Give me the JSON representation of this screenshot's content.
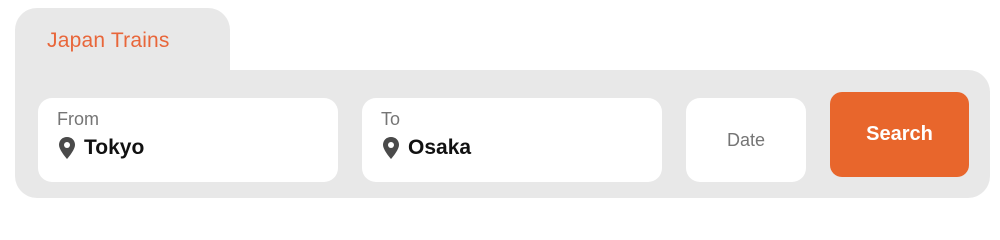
{
  "header": {
    "tab_label": "Japan Trains"
  },
  "search": {
    "from": {
      "label": "From",
      "value": "Tokyo",
      "icon": "location-pin-icon"
    },
    "to": {
      "label": "To",
      "value": "Osaka",
      "icon": "location-pin-icon"
    },
    "date": {
      "placeholder": "Date"
    },
    "button_label": "Search"
  },
  "colors": {
    "accent": "#e8662c",
    "tab_text": "#e8663a",
    "panel_bg": "#e8e8e8",
    "field_bg": "#ffffff",
    "label_text": "#757575",
    "value_text": "#111111"
  }
}
